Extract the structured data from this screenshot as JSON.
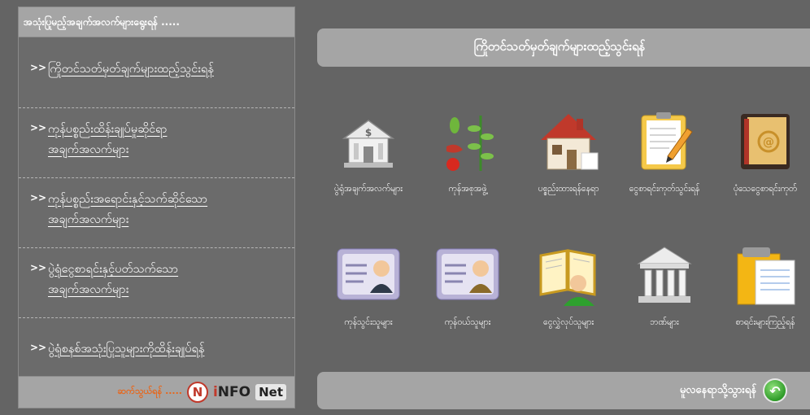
{
  "sidebar": {
    "header": "အသုံးပြုမည့်အချက်အလက်များရွေးရန် .....",
    "items": [
      {
        "label": "ကြိုတင်သတ်မှတ်ချက်များထည့်သွင်းရန်"
      },
      {
        "label": "ကုန်ပစ္စည်းထိန်းချုပ်မှုဆိုင်ရာ\nအချက်အလက်များ"
      },
      {
        "label": "ကုန်ပစ္စည်းအရောင်းနှင့်သက်ဆိုင်သော\nအချက်အလက်များ"
      },
      {
        "label": "ပွဲရုံငွေစာရင်းနှင့်ပတ်သက်သော\nအချက်အလက်များ"
      },
      {
        "label": "ပွဲရုံစနစ်အသုံးပြုသူများကိုထိန်းချုပ်ရန်"
      }
    ],
    "arrow": ">>",
    "footer_text": "ဆက်သွယ်ရန် .....",
    "brand_n": "N",
    "brand_i": "i",
    "brand_nfo": "NFO",
    "brand_net": "Net"
  },
  "main": {
    "title": "ကြိုတင်သတ်မှတ်ချက်များထည့်သွင်းရန်",
    "icons": [
      {
        "label": "ပွဲရုံအချက်အလက်များ",
        "icon": "bank-building-icon"
      },
      {
        "label": "ကုန်အစုအဖွဲ့",
        "icon": "crops-icon"
      },
      {
        "label": "ပစ္စည်းထားရန်နေရာ",
        "icon": "house-icon"
      },
      {
        "label": "ငွေစာရင်းကုတ်သွင်းရန်",
        "icon": "clipboard-pencil-icon"
      },
      {
        "label": "ပုံသေငွေစာရင်းကုတ်",
        "icon": "address-book-icon"
      },
      {
        "label": "ကုန်သွင်းသူများ",
        "icon": "supplier-card-icon"
      },
      {
        "label": "ကုန်ဝယ်သူများ",
        "icon": "customer-card-icon"
      },
      {
        "label": "ငွေလွှဲလုပ်သူများ",
        "icon": "reader-book-icon"
      },
      {
        "label": "ဘဏ်များ",
        "icon": "bank-columns-icon"
      },
      {
        "label": "စာရင်းများကြည့်ရန်",
        "icon": "document-folder-icon"
      }
    ],
    "back_label": "မူလနေရာသို့သွားရန်"
  }
}
